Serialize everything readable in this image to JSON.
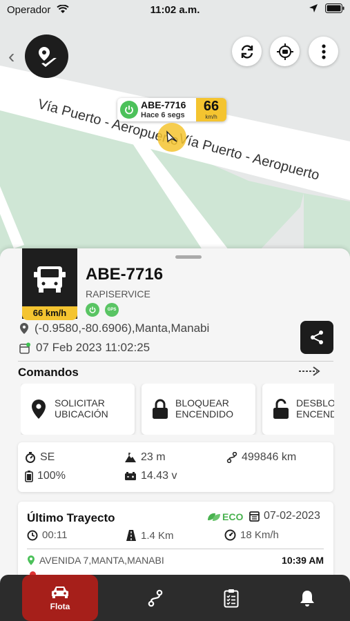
{
  "status_bar": {
    "carrier": "Operador",
    "time": "11:02 a.m."
  },
  "map": {
    "road_label_1": "Vía Puerto - Aeropuerto",
    "road_label_2": "Vía Puerto - Aeropuerto",
    "colors": {
      "land": "#e6e8e8",
      "park": "#cfe6d5",
      "road": "#ffffff",
      "accent": "#f4c430"
    }
  },
  "marker": {
    "plate": "ABE-7716",
    "ago": "Hace 6 segs",
    "speed": "66",
    "speed_unit": "km/h"
  },
  "vehicle": {
    "speed_label": "66 km/h",
    "plate": "ABE-7716",
    "company": "RAPISERVICE",
    "badge_gps": "GPS",
    "location": "(-0.9580,-80.6906),Manta,Manabi",
    "datetime": "07 Feb 2023 11:02:25"
  },
  "commands": {
    "title": "Comandos",
    "items": [
      {
        "label": "SOLICITAR\nUBICACIÓN",
        "icon": "location-pin-icon"
      },
      {
        "label": "BLOQUEAR\nENCENDIDO",
        "icon": "lock-icon"
      },
      {
        "label": "DESBLOQUEAR\nENCENDIDO",
        "icon": "unlock-icon"
      }
    ]
  },
  "stats": {
    "heading": "SE",
    "altitude": "23 m",
    "odometer": "499846 km",
    "battery": "100%",
    "voltage": "14.43 v"
  },
  "last_trip": {
    "title": "Último Trayecto",
    "eco": "ECO",
    "date": "07-02-2023",
    "duration": "00:11",
    "distance": "1.4 Km",
    "avg_speed": "18 Km/h",
    "start_address": "AVENIDA 7,MANTA,MANABI",
    "start_time": "10:39 AM"
  },
  "tabbar": {
    "active": "Flota",
    "items": [
      {
        "label": "Flota",
        "icon": "car-icon"
      },
      {
        "label": "",
        "icon": "route-icon"
      },
      {
        "label": "",
        "icon": "clipboard-icon"
      },
      {
        "label": "",
        "icon": "bell-icon"
      }
    ]
  }
}
